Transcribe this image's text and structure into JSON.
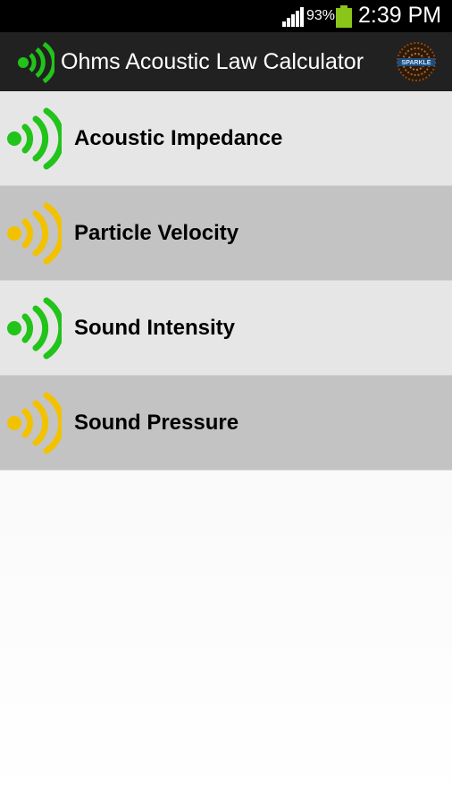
{
  "status_bar": {
    "battery_percent": "93%",
    "time": "2:39 PM",
    "icons": [
      "signal-icon",
      "battery-icon"
    ]
  },
  "action_bar": {
    "title": "Ohms Acoustic Law Calculator",
    "app_icon": "sound-wave-icon",
    "brand_logo_text": "SPARKLE"
  },
  "list": {
    "items": [
      {
        "label": "Acoustic Impedance",
        "icon": "sound-wave-green-icon",
        "color": "#22c31a"
      },
      {
        "label": "Particle Velocity",
        "icon": "sound-wave-yellow-icon",
        "color": "#f2c200"
      },
      {
        "label": "Sound Intensity",
        "icon": "sound-wave-green-icon",
        "color": "#22c31a"
      },
      {
        "label": "Sound Pressure",
        "icon": "sound-wave-yellow-icon",
        "color": "#f2c200"
      }
    ]
  },
  "colors": {
    "status_bar_bg": "#000000",
    "action_bar_bg": "#212121",
    "row_light": "#e6e6e6",
    "row_dark": "#c3c3c3",
    "accent_green": "#22c31a",
    "accent_yellow": "#f2c200"
  }
}
